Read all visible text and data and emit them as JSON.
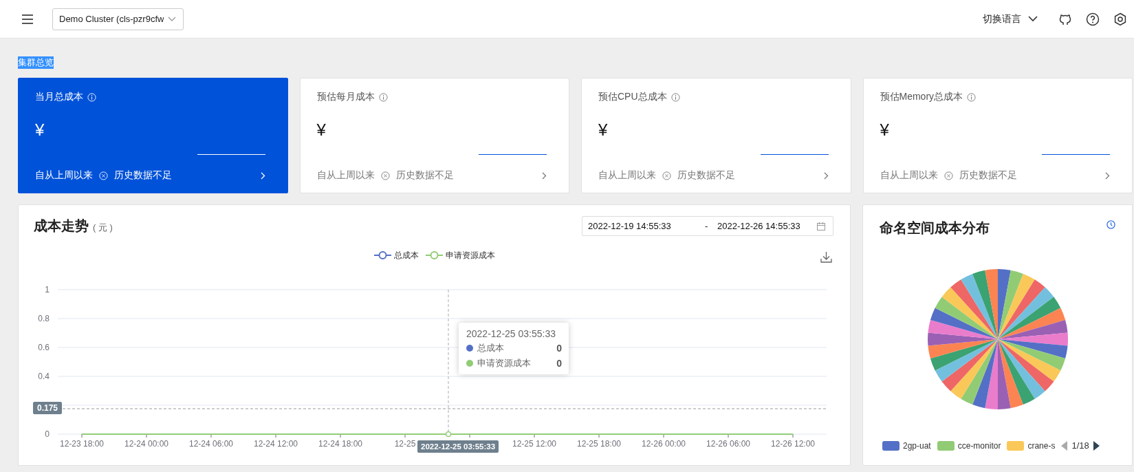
{
  "header": {
    "cluster_select": "Demo Cluster (cls-pzr9cfw",
    "language": "切换语言"
  },
  "section_title": "集群总览",
  "cards": [
    {
      "title": "当月总成本",
      "currency": "¥",
      "since": "自从上周以来",
      "status": "历史数据不足",
      "selected": true
    },
    {
      "title": "预估每月成本",
      "currency": "¥",
      "since": "自从上周以来",
      "status": "历史数据不足",
      "selected": false
    },
    {
      "title": "预估CPU总成本",
      "currency": "¥",
      "since": "自从上周以来",
      "status": "历史数据不足",
      "selected": false
    },
    {
      "title": "预估Memory总成本",
      "currency": "¥",
      "since": "自从上周以来",
      "status": "历史数据不足",
      "selected": false
    }
  ],
  "trend": {
    "title": "成本走势",
    "unit": "( 元 )",
    "date_start": "2022-12-19 14:55:33",
    "date_sep": "-",
    "date_end": "2022-12-26 14:55:33",
    "chart_data": {
      "type": "line",
      "categories": [
        "12-23 18:00",
        "12-24 00:00",
        "12-24 06:00",
        "12-24 12:00",
        "12-24 18:00",
        "12-25",
        null,
        "12-25 12:00",
        "12-25 18:00",
        "12-26 00:00",
        "12-26 06:00",
        "12-26 12:00"
      ],
      "series": [
        {
          "name": "总成本",
          "color": "#5470c6",
          "values": [
            null,
            null,
            null,
            null,
            null,
            null,
            null,
            null,
            null,
            null,
            null,
            null
          ]
        },
        {
          "name": "申请资源成本",
          "color": "#91cc75",
          "values": [
            0,
            0,
            0,
            0,
            0,
            0,
            0,
            0,
            0,
            0,
            0,
            0
          ]
        }
      ],
      "ylim": [
        0,
        1
      ],
      "yticks": [
        0,
        0.4,
        0.6,
        0.8,
        1
      ],
      "grid": true,
      "legend": "top"
    },
    "pointer": {
      "y_label": "0.175",
      "x_label": "2022-12-25 03:55:33"
    },
    "tooltip": {
      "time": "2022-12-25 03:55:33",
      "rows": [
        {
          "name": "总成本",
          "value": "0",
          "color": "#5470c6"
        },
        {
          "name": "申请资源成本",
          "value": "0",
          "color": "#91cc75"
        }
      ]
    }
  },
  "namespace": {
    "title": "命名空间成本分布",
    "legend": [
      {
        "name": "2gp-uat",
        "color": "#5470c6"
      },
      {
        "name": "cce-monitor",
        "color": "#91cc75"
      },
      {
        "name": "crane-s",
        "color": "#fac858"
      }
    ],
    "pager": {
      "text": "1/18",
      "prev_disabled": true,
      "next_disabled": false
    }
  }
}
